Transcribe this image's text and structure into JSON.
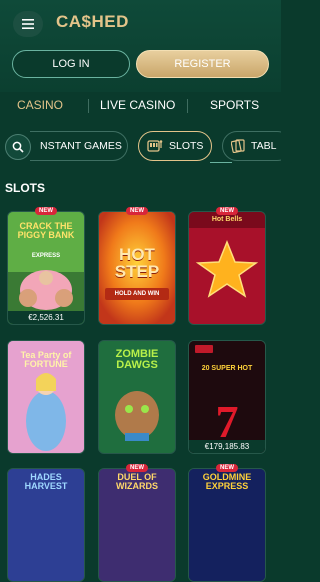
{
  "header": {
    "logo_text": "CA$HED",
    "login_label": "LOG IN",
    "register_label": "REGISTER"
  },
  "nav": {
    "tabs": [
      "CASINO",
      "LIVE CASINO",
      "SPORTS"
    ],
    "active": "CASINO"
  },
  "categories": {
    "items": [
      "NSTANT GAMES",
      "SLOTS",
      "TABL"
    ],
    "active": "SLOTS"
  },
  "section": {
    "title": "SLOTS"
  },
  "games": [
    {
      "title": "CRACK THE PIGGY BANK",
      "subtitle": "EXPRESS",
      "badge": "NEW",
      "jackpot": "€2,526.31"
    },
    {
      "title": "HOT STEP",
      "subtitle": "HOLD AND WIN",
      "badge": "NEW",
      "jackpot": ""
    },
    {
      "title": "Hot Bells",
      "subtitle": "",
      "badge": "NEW",
      "jackpot": ""
    },
    {
      "title": "Tea Party of FORTUNE",
      "subtitle": "",
      "badge": "",
      "jackpot": ""
    },
    {
      "title": "ZOMBIE DAWGS",
      "subtitle": "",
      "badge": "",
      "jackpot": ""
    },
    {
      "title": "20 SUPER HOT",
      "subtitle": "",
      "badge": "",
      "jackpot": "€179,185.83"
    },
    {
      "title": "HADES HARVEST",
      "subtitle": "",
      "badge": "",
      "jackpot": ""
    },
    {
      "title": "DUEL OF WIZARDS",
      "subtitle": "",
      "badge": "NEW",
      "jackpot": ""
    },
    {
      "title": "GOLDMINE EXPRESS",
      "subtitle": "",
      "badge": "NEW",
      "jackpot": ""
    }
  ],
  "colors": {
    "background": "#0a3a2c",
    "accent": "#e3c48a",
    "badge": "#d8263a"
  }
}
